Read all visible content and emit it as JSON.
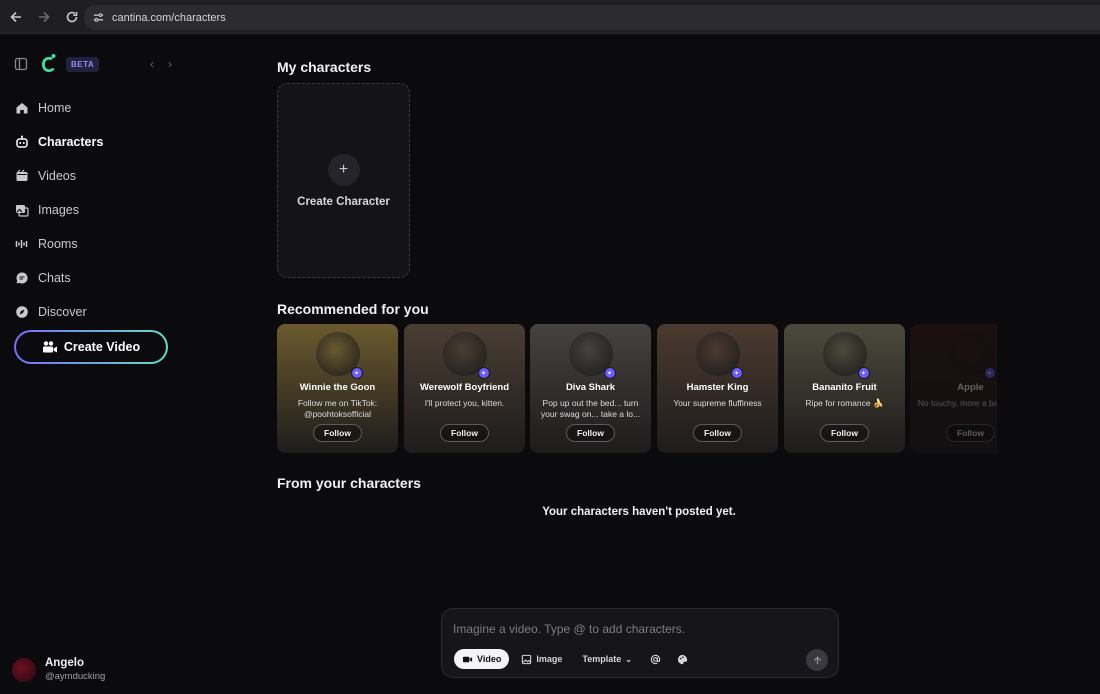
{
  "browser": {
    "url": "cantina.com/characters"
  },
  "sidebar": {
    "beta_label": "BETA",
    "items": [
      {
        "label": "Home",
        "icon": "home-icon"
      },
      {
        "label": "Characters",
        "icon": "robot-icon",
        "active": true
      },
      {
        "label": "Videos",
        "icon": "video-icon"
      },
      {
        "label": "Images",
        "icon": "images-icon"
      },
      {
        "label": "Rooms",
        "icon": "audio-wave-icon"
      },
      {
        "label": "Chats",
        "icon": "chat-icon"
      },
      {
        "label": "Discover",
        "icon": "compass-icon"
      }
    ],
    "create_video_label": "Create Video",
    "profile": {
      "name": "Angelo",
      "handle": "@aymducking"
    }
  },
  "main": {
    "my_characters_title": "My characters",
    "create_character_label": "Create Character",
    "recommended_title": "Recommended for you",
    "recommended": [
      {
        "name": "Winnie the Goon",
        "bio": "Follow me on TikTok: @poohtoksofficial",
        "follow": "Follow",
        "color": "#6b5a2e"
      },
      {
        "name": "Werewolf Boyfriend",
        "bio": "I'll protect you, kitten.",
        "follow": "Follow",
        "color": "#4a3e33"
      },
      {
        "name": "Diva Shark",
        "bio": "Pop up out the bed... turn your swag on... take a lo...",
        "follow": "Follow",
        "color": "#45423f"
      },
      {
        "name": "Hamster King",
        "bio": "Your supreme fluffiness",
        "follow": "Follow",
        "color": "#4b3a30"
      },
      {
        "name": "Bananito Fruit",
        "bio": "Ripe for romance 🍌",
        "follow": "Follow",
        "color": "#4a4a3c"
      },
      {
        "name": "Apple",
        "bio": "No touchy, more a babe! 🍎",
        "follow": "Follow",
        "color": "#3a1a1a"
      }
    ],
    "from_characters_title": "From your characters",
    "empty_message": "Your characters haven't posted yet."
  },
  "composer": {
    "placeholder": "Imagine a video. Type @ to add characters.",
    "video_label": "Video",
    "image_label": "Image",
    "template_label": "Template"
  }
}
